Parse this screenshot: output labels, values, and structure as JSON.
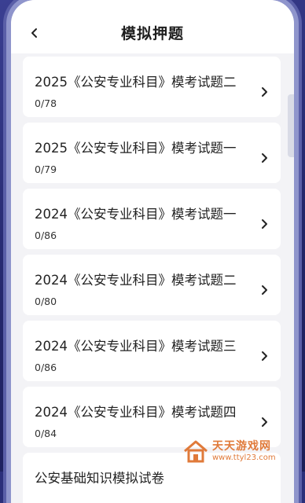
{
  "header": {
    "title": "模拟押题",
    "back_icon": "chevron-left-icon"
  },
  "exams": [
    {
      "title": "2025《公安专业科目》模考试题二",
      "progress": "0/78"
    },
    {
      "title": "2025《公安专业科目》模考试题一",
      "progress": "0/79"
    },
    {
      "title": "2024《公安专业科目》模考试题一",
      "progress": "0/86"
    },
    {
      "title": "2024《公安专业科目》模考试题二",
      "progress": "0/80"
    },
    {
      "title": "2024《公安专业科目》模考试题三",
      "progress": "0/86"
    },
    {
      "title": "2024《公安专业科目》模考试题四",
      "progress": "0/84"
    },
    {
      "title": "公安基础知识模拟试卷",
      "progress": ""
    }
  ],
  "watermark": {
    "title": "天天游戏网",
    "url": "www.ttyl23.com",
    "logo": "house-logo-icon"
  },
  "colors": {
    "accent": "#e07a3a",
    "frame": "#5a5fa8",
    "background": "#f3f3f6"
  }
}
